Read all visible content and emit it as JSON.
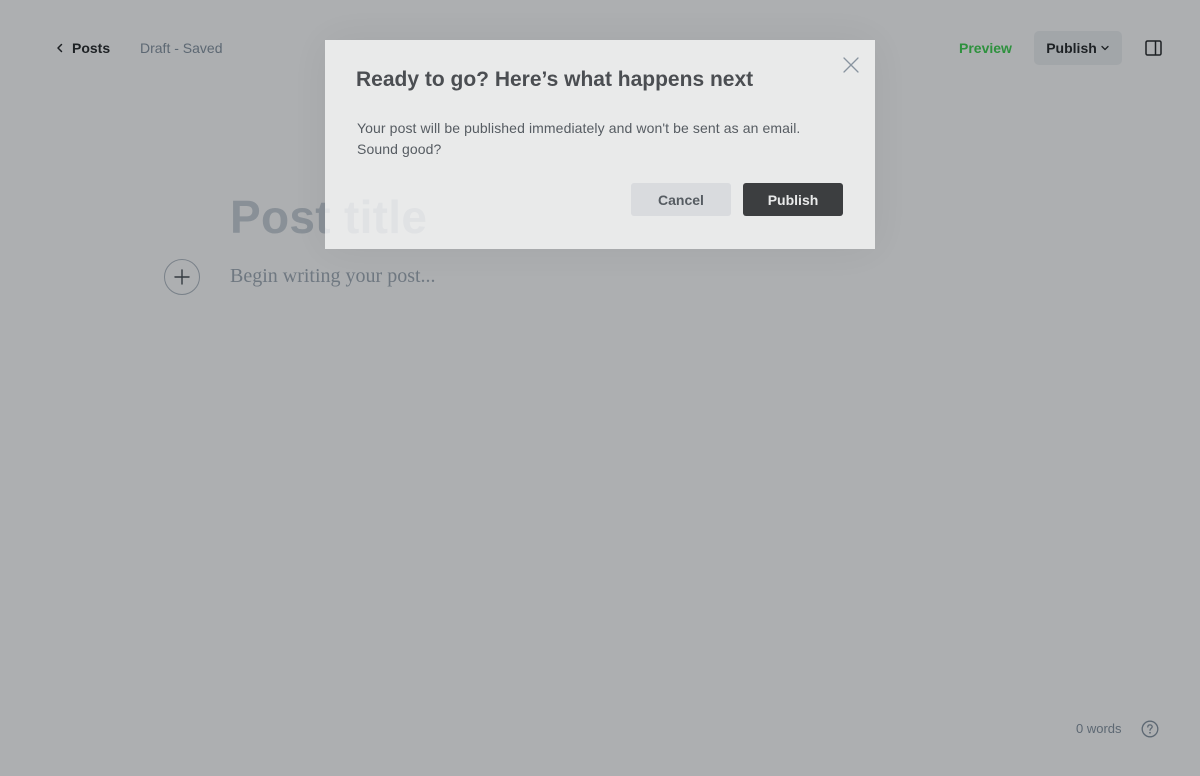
{
  "header": {
    "back_label": "Posts",
    "status": "Draft - Saved",
    "preview_label": "Preview",
    "publish_label": "Publish"
  },
  "editor": {
    "title_placeholder": "Post title",
    "body_placeholder": "Begin writing your post..."
  },
  "footer": {
    "word_count": "0 words"
  },
  "modal": {
    "title": "Ready to go? Here’s what happens next",
    "text": "Your post will be published immediately and won't be sent as an email. Sound good?",
    "cancel_label": "Cancel",
    "publish_label": "Publish"
  },
  "icons": {
    "back": "chevron-left-icon",
    "publish_menu": "chevron-down-icon",
    "sidebar": "sidebar-panel-icon",
    "add": "plus-icon",
    "help": "question-circle-icon",
    "close": "close-icon"
  },
  "colors": {
    "accent_green": "#30cf43",
    "primary_button": "#15171a",
    "overlay": "#2d3035"
  }
}
